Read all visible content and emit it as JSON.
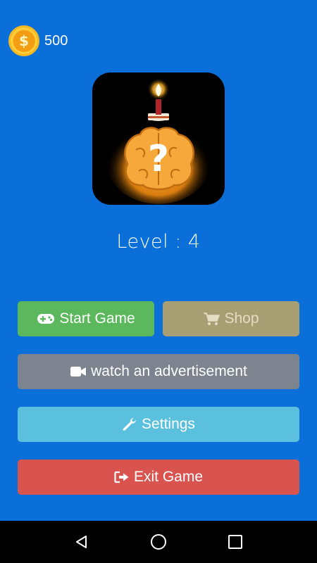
{
  "coins": {
    "count": "500",
    "symbol": "$"
  },
  "logo": {
    "icon": "brain-question-candle-icon",
    "glyph": "?"
  },
  "level": {
    "text": "Level : 4"
  },
  "buttons": {
    "start": "Start Game",
    "shop": "Shop",
    "ad": "watch an advertisement",
    "settings": "Settings",
    "exit": "Exit Game"
  },
  "colors": {
    "background": "#0a6fd8",
    "start": "#5cb85c",
    "shop": "#a89e74",
    "ad": "#7d8490",
    "settings": "#5bc0de",
    "exit": "#d9534f"
  },
  "navbar": {
    "icons": [
      "back-icon",
      "home-icon",
      "recents-icon"
    ]
  }
}
